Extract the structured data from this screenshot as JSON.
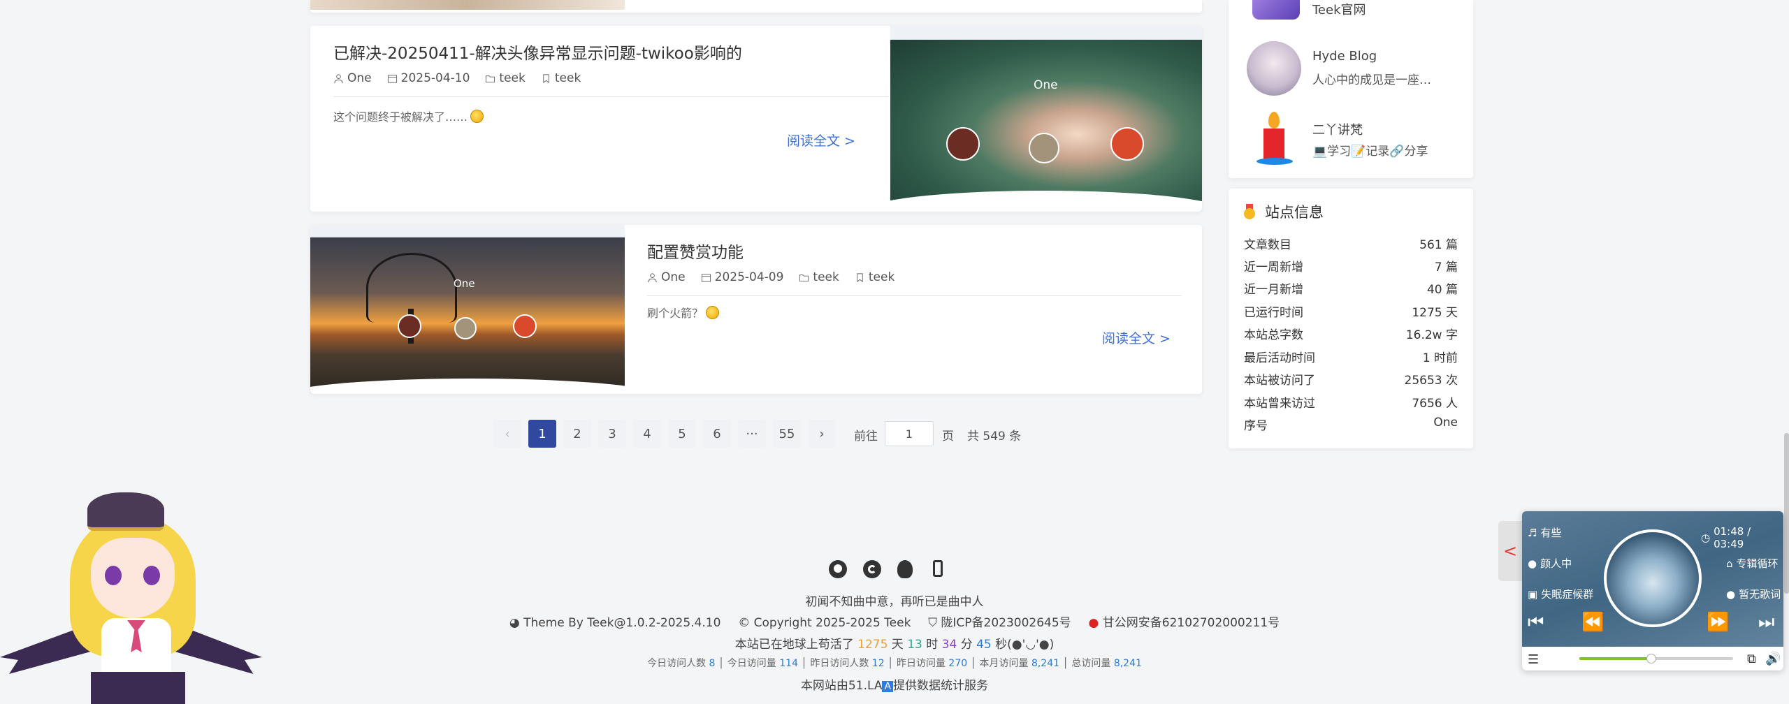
{
  "posts": [
    {
      "title": "已解决-20250411-解决头像异常显示问题-twikoo影响的",
      "author": "One",
      "date": "2025-04-10",
      "category": "teek",
      "tag": "teek",
      "excerpt": "这个问题终于被解决了……",
      "read_more": "阅读全文 >",
      "thumb_text": "One"
    },
    {
      "title": "配置赞赏功能",
      "author": "One",
      "date": "2025-04-09",
      "category": "teek",
      "tag": "teek",
      "excerpt": "刷个火箭？",
      "read_more": "阅读全文 >",
      "thumb_text": "One"
    }
  ],
  "pagination": {
    "pages": [
      "1",
      "2",
      "3",
      "4",
      "5",
      "6",
      "···",
      "55"
    ],
    "current": "1",
    "goto_label": "前往",
    "goto_value": "1",
    "page_unit": "页",
    "total": "共 549 条",
    "prev": "‹",
    "next": "›"
  },
  "friends": [
    {
      "name": "Teek官网",
      "desc": ""
    },
    {
      "name": "Hyde Blog",
      "desc": "人心中的成见是一座…"
    },
    {
      "name": "二丫讲梵",
      "desc": "💻学习📝记录🔗分享"
    }
  ],
  "site_info": {
    "title": "站点信息",
    "rows": [
      {
        "label": "文章数目",
        "value": "561 篇"
      },
      {
        "label": "近一周新增",
        "value": "7 篇"
      },
      {
        "label": "近一月新增",
        "value": "40 篇"
      },
      {
        "label": "已运行时间",
        "value": "1275 天"
      },
      {
        "label": "本站总字数",
        "value": "16.2w 字"
      },
      {
        "label": "最后活动时间",
        "value": "1 时前"
      },
      {
        "label": "本站被访问了",
        "value": "25653 次"
      },
      {
        "label": "本站曾来访过",
        "value": "7656 人"
      },
      {
        "label": "序号",
        "value": "One"
      }
    ]
  },
  "footer": {
    "motto": "初闻不知曲中意，再听已是曲中人",
    "theme": "Theme By Teek@1.0.2-2025.4.10",
    "copyright": "Copyright 2025-2025 Teek",
    "icp": "陇ICP备2023002645号",
    "police": "甘公网安备62102702000211号",
    "runtime_prefix": "本站已在地球上苟活了",
    "days": "1275",
    "days_unit": "天",
    "hours": "13",
    "hours_unit": "时",
    "minutes": "34",
    "minutes_unit": "分",
    "seconds": "45",
    "seconds_unit": "秒(●'◡'●)",
    "stats": [
      {
        "label": "今日访问人数",
        "value": "8"
      },
      {
        "label": "今日访问量",
        "value": "114"
      },
      {
        "label": "昨日访问人数",
        "value": "12"
      },
      {
        "label": "昨日访问量",
        "value": "270"
      },
      {
        "label": "本月访问量",
        "value": "8,241"
      },
      {
        "label": "总访问量",
        "value": "8,241"
      }
    ],
    "stats_provider": "本网站由51.LA",
    "stats_provider_badge": "A",
    "stats_provider_suffix": "提供数据统计服务"
  },
  "player": {
    "song": "有些",
    "artist": "颜人中",
    "album": "失眠症候群",
    "time": "01:48 / 03:49",
    "mode": "专辑循环",
    "lyrics": "暂无歌词",
    "progress": 0.47,
    "toggle": "<"
  },
  "colors": {
    "accent": "#3148a0",
    "link": "#3d6fd8",
    "days": "#f0a030",
    "hours": "#2aa58a",
    "minutes": "#8a3fd1",
    "seconds": "#2e7bd6"
  }
}
